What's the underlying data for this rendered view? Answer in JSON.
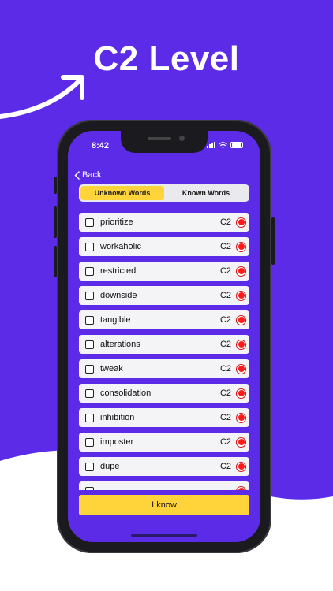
{
  "headline": "C2 Level",
  "status": {
    "time": "8:42"
  },
  "nav": {
    "back_label": "Back"
  },
  "tabs": [
    {
      "label": "Unknown Words",
      "active": true
    },
    {
      "label": "Known Words",
      "active": false
    }
  ],
  "words": [
    {
      "word": "prioritize",
      "level": "C2"
    },
    {
      "word": "workaholic",
      "level": "C2"
    },
    {
      "word": "restricted",
      "level": "C2"
    },
    {
      "word": "downside",
      "level": "C2"
    },
    {
      "word": "tangible",
      "level": "C2"
    },
    {
      "word": "alterations",
      "level": "C2"
    },
    {
      "word": "tweak",
      "level": "C2"
    },
    {
      "word": "consolidation",
      "level": "C2"
    },
    {
      "word": "inhibition",
      "level": "C2"
    },
    {
      "word": "imposter",
      "level": "C2"
    },
    {
      "word": "dupe",
      "level": "C2"
    }
  ],
  "primary_button": "I know",
  "colors": {
    "background": "#5b2be8",
    "accent": "#ffd43a",
    "status_dot": "#ff1a1a"
  }
}
